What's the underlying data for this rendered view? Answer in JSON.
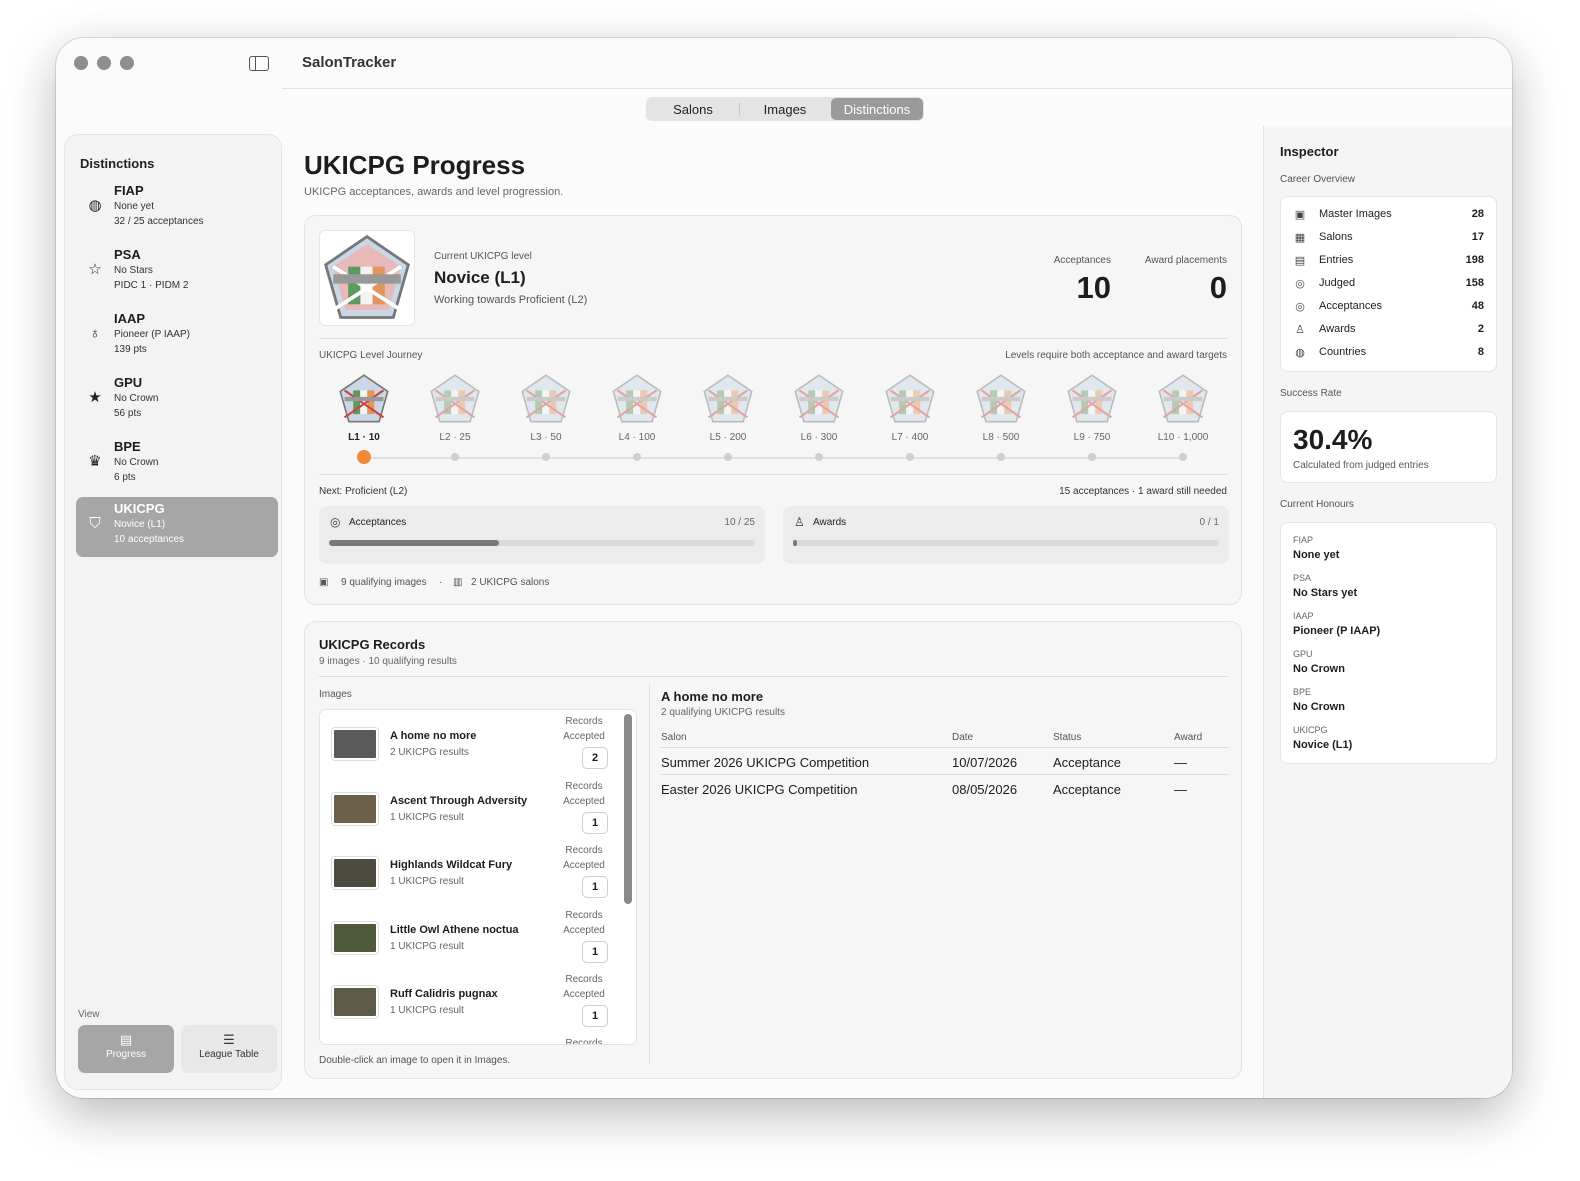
{
  "app": {
    "title": "SalonTracker"
  },
  "tabs": [
    {
      "label": "Salons"
    },
    {
      "label": "Images"
    },
    {
      "label": "Distinctions",
      "active": true
    }
  ],
  "sidebar": {
    "heading": "Distinctions",
    "items": [
      {
        "name": "FIAP",
        "line1": "None yet",
        "line2": "32 / 25 acceptances",
        "icon": "globe-icon"
      },
      {
        "name": "PSA",
        "line1": "No Stars",
        "line2": "PIDC 1 · PIDM 2",
        "icon": "star-outline-icon"
      },
      {
        "name": "IAAP",
        "line1": "Pioneer (P IAAP)",
        "line2": "139 pts",
        "icon": "rosette-icon"
      },
      {
        "name": "GPU",
        "line1": "No Crown",
        "line2": "56 pts",
        "icon": "star-filled-icon"
      },
      {
        "name": "BPE",
        "line1": "No Crown",
        "line2": "6 pts",
        "icon": "crown-icon"
      },
      {
        "name": "UKICPG",
        "line1": "Novice (L1)",
        "line2": "10 acceptances",
        "icon": "shield-icon",
        "selected": true
      }
    ],
    "view_label": "View",
    "view_buttons": [
      {
        "label": "Progress",
        "icon": "document-icon",
        "active": true
      },
      {
        "label": "League Table",
        "icon": "list-icon"
      }
    ]
  },
  "main": {
    "title": "UKICPG Progress",
    "subtitle": "UKICPG acceptances, awards and level progression.",
    "progress": {
      "current_label": "Current UKICPG level",
      "current_level": "Novice (L1)",
      "working_towards": "Working towards Proficient (L2)",
      "acceptances_label": "Acceptances",
      "acceptances_value": "10",
      "awards_label": "Award placements",
      "awards_value": "0",
      "journey_label": "UKICPG Level Journey",
      "journey_note": "Levels require both acceptance and award targets",
      "levels": [
        "L1 · 10",
        "L2 · 25",
        "L3 · 50",
        "L4 · 100",
        "L5 · 200",
        "L6 · 300",
        "L7 · 400",
        "L8 · 500",
        "L9 · 750",
        "L10 · 1,000"
      ],
      "current_level_index": 0,
      "next_label": "Next: Proficient (L2)",
      "next_needed": "15 acceptances · 1 award still needed",
      "bars": [
        {
          "title": "Acceptances",
          "value": "10 / 25",
          "fraction": 0.4,
          "icon": "check-circle-icon"
        },
        {
          "title": "Awards",
          "value": "0 / 1",
          "fraction": 0.0,
          "icon": "trophy-icon"
        }
      ],
      "qualifying_images": "9 qualifying images",
      "salons": "2 UKICPG salons"
    },
    "records": {
      "title": "UKICPG Records",
      "subtitle": "9 images · 10 qualifying results",
      "images_label": "Images",
      "records_accepted_label": "Records Accepted",
      "images": [
        {
          "name": "A home no more",
          "results": "2 UKICPG results",
          "count": "2",
          "color": "#5a5a5a"
        },
        {
          "name": "Ascent Through Adversity",
          "results": "1 UKICPG result",
          "count": "1",
          "color": "#6b6048"
        },
        {
          "name": "Highlands Wildcat Fury",
          "results": "1 UKICPG result",
          "count": "1",
          "color": "#4d4a40"
        },
        {
          "name": "Little Owl Athene noctua",
          "results": "1 UKICPG result",
          "count": "1",
          "color": "#4f5a3a"
        },
        {
          "name": "Ruff Calidris pugnax",
          "results": "1 UKICPG result",
          "count": "1",
          "color": "#5d5a48"
        }
      ],
      "next_partial": "Records",
      "hint": "Double-click an image to open it in Images.",
      "detail_title": "A home no more",
      "detail_sub": "2 qualifying UKICPG results",
      "columns": [
        "Salon",
        "Date",
        "Status",
        "Award"
      ],
      "rows": [
        {
          "salon": "Summer 2026 UKICPG Competition",
          "date": "10/07/2026",
          "status": "Acceptance",
          "award": "—"
        },
        {
          "salon": "Easter 2026 UKICPG Competition",
          "date": "08/05/2026",
          "status": "Acceptance",
          "award": "—"
        }
      ]
    }
  },
  "inspector": {
    "title": "Inspector",
    "overview_label": "Career Overview",
    "overview": [
      {
        "label": "Master Images",
        "value": "28",
        "icon": "image-icon"
      },
      {
        "label": "Salons",
        "value": "17",
        "icon": "calendar-icon"
      },
      {
        "label": "Entries",
        "value": "198",
        "icon": "stack-icon"
      },
      {
        "label": "Judged",
        "value": "158",
        "icon": "check-circle-icon"
      },
      {
        "label": "Acceptances",
        "value": "48",
        "icon": "check-circle-icon"
      },
      {
        "label": "Awards",
        "value": "2",
        "icon": "trophy-icon"
      },
      {
        "label": "Countries",
        "value": "8",
        "icon": "globe-icon"
      }
    ],
    "success_label": "Success Rate",
    "success_rate": "30.4%",
    "success_note": "Calculated from judged entries",
    "honours_label": "Current Honours",
    "honours": [
      {
        "org": "FIAP",
        "value": "None yet"
      },
      {
        "org": "PSA",
        "value": "No Stars yet"
      },
      {
        "org": "IAAP",
        "value": "Pioneer (P IAAP)"
      },
      {
        "org": "GPU",
        "value": "No Crown"
      },
      {
        "org": "BPE",
        "value": "No Crown"
      },
      {
        "org": "UKICPG",
        "value": "Novice (L1)"
      }
    ]
  }
}
